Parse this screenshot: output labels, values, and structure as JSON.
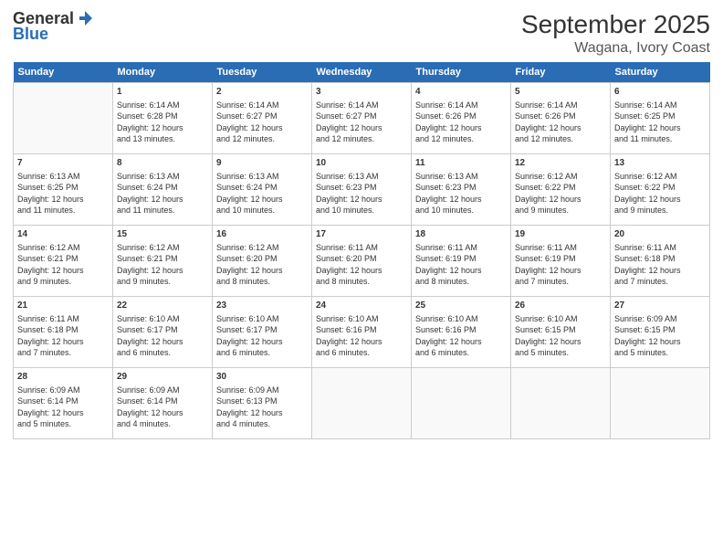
{
  "logo": {
    "general": "General",
    "blue": "Blue",
    "icon": "▶"
  },
  "title": "September 2025",
  "subtitle": "Wagana, Ivory Coast",
  "days": [
    "Sunday",
    "Monday",
    "Tuesday",
    "Wednesday",
    "Thursday",
    "Friday",
    "Saturday"
  ],
  "weeks": [
    [
      {
        "num": "",
        "lines": []
      },
      {
        "num": "1",
        "lines": [
          "Sunrise: 6:14 AM",
          "Sunset: 6:28 PM",
          "Daylight: 12 hours",
          "and 13 minutes."
        ]
      },
      {
        "num": "2",
        "lines": [
          "Sunrise: 6:14 AM",
          "Sunset: 6:27 PM",
          "Daylight: 12 hours",
          "and 12 minutes."
        ]
      },
      {
        "num": "3",
        "lines": [
          "Sunrise: 6:14 AM",
          "Sunset: 6:27 PM",
          "Daylight: 12 hours",
          "and 12 minutes."
        ]
      },
      {
        "num": "4",
        "lines": [
          "Sunrise: 6:14 AM",
          "Sunset: 6:26 PM",
          "Daylight: 12 hours",
          "and 12 minutes."
        ]
      },
      {
        "num": "5",
        "lines": [
          "Sunrise: 6:14 AM",
          "Sunset: 6:26 PM",
          "Daylight: 12 hours",
          "and 12 minutes."
        ]
      },
      {
        "num": "6",
        "lines": [
          "Sunrise: 6:14 AM",
          "Sunset: 6:25 PM",
          "Daylight: 12 hours",
          "and 11 minutes."
        ]
      }
    ],
    [
      {
        "num": "7",
        "lines": [
          "Sunrise: 6:13 AM",
          "Sunset: 6:25 PM",
          "Daylight: 12 hours",
          "and 11 minutes."
        ]
      },
      {
        "num": "8",
        "lines": [
          "Sunrise: 6:13 AM",
          "Sunset: 6:24 PM",
          "Daylight: 12 hours",
          "and 11 minutes."
        ]
      },
      {
        "num": "9",
        "lines": [
          "Sunrise: 6:13 AM",
          "Sunset: 6:24 PM",
          "Daylight: 12 hours",
          "and 10 minutes."
        ]
      },
      {
        "num": "10",
        "lines": [
          "Sunrise: 6:13 AM",
          "Sunset: 6:23 PM",
          "Daylight: 12 hours",
          "and 10 minutes."
        ]
      },
      {
        "num": "11",
        "lines": [
          "Sunrise: 6:13 AM",
          "Sunset: 6:23 PM",
          "Daylight: 12 hours",
          "and 10 minutes."
        ]
      },
      {
        "num": "12",
        "lines": [
          "Sunrise: 6:12 AM",
          "Sunset: 6:22 PM",
          "Daylight: 12 hours",
          "and 9 minutes."
        ]
      },
      {
        "num": "13",
        "lines": [
          "Sunrise: 6:12 AM",
          "Sunset: 6:22 PM",
          "Daylight: 12 hours",
          "and 9 minutes."
        ]
      }
    ],
    [
      {
        "num": "14",
        "lines": [
          "Sunrise: 6:12 AM",
          "Sunset: 6:21 PM",
          "Daylight: 12 hours",
          "and 9 minutes."
        ]
      },
      {
        "num": "15",
        "lines": [
          "Sunrise: 6:12 AM",
          "Sunset: 6:21 PM",
          "Daylight: 12 hours",
          "and 9 minutes."
        ]
      },
      {
        "num": "16",
        "lines": [
          "Sunrise: 6:12 AM",
          "Sunset: 6:20 PM",
          "Daylight: 12 hours",
          "and 8 minutes."
        ]
      },
      {
        "num": "17",
        "lines": [
          "Sunrise: 6:11 AM",
          "Sunset: 6:20 PM",
          "Daylight: 12 hours",
          "and 8 minutes."
        ]
      },
      {
        "num": "18",
        "lines": [
          "Sunrise: 6:11 AM",
          "Sunset: 6:19 PM",
          "Daylight: 12 hours",
          "and 8 minutes."
        ]
      },
      {
        "num": "19",
        "lines": [
          "Sunrise: 6:11 AM",
          "Sunset: 6:19 PM",
          "Daylight: 12 hours",
          "and 7 minutes."
        ]
      },
      {
        "num": "20",
        "lines": [
          "Sunrise: 6:11 AM",
          "Sunset: 6:18 PM",
          "Daylight: 12 hours",
          "and 7 minutes."
        ]
      }
    ],
    [
      {
        "num": "21",
        "lines": [
          "Sunrise: 6:11 AM",
          "Sunset: 6:18 PM",
          "Daylight: 12 hours",
          "and 7 minutes."
        ]
      },
      {
        "num": "22",
        "lines": [
          "Sunrise: 6:10 AM",
          "Sunset: 6:17 PM",
          "Daylight: 12 hours",
          "and 6 minutes."
        ]
      },
      {
        "num": "23",
        "lines": [
          "Sunrise: 6:10 AM",
          "Sunset: 6:17 PM",
          "Daylight: 12 hours",
          "and 6 minutes."
        ]
      },
      {
        "num": "24",
        "lines": [
          "Sunrise: 6:10 AM",
          "Sunset: 6:16 PM",
          "Daylight: 12 hours",
          "and 6 minutes."
        ]
      },
      {
        "num": "25",
        "lines": [
          "Sunrise: 6:10 AM",
          "Sunset: 6:16 PM",
          "Daylight: 12 hours",
          "and 6 minutes."
        ]
      },
      {
        "num": "26",
        "lines": [
          "Sunrise: 6:10 AM",
          "Sunset: 6:15 PM",
          "Daylight: 12 hours",
          "and 5 minutes."
        ]
      },
      {
        "num": "27",
        "lines": [
          "Sunrise: 6:09 AM",
          "Sunset: 6:15 PM",
          "Daylight: 12 hours",
          "and 5 minutes."
        ]
      }
    ],
    [
      {
        "num": "28",
        "lines": [
          "Sunrise: 6:09 AM",
          "Sunset: 6:14 PM",
          "Daylight: 12 hours",
          "and 5 minutes."
        ]
      },
      {
        "num": "29",
        "lines": [
          "Sunrise: 6:09 AM",
          "Sunset: 6:14 PM",
          "Daylight: 12 hours",
          "and 4 minutes."
        ]
      },
      {
        "num": "30",
        "lines": [
          "Sunrise: 6:09 AM",
          "Sunset: 6:13 PM",
          "Daylight: 12 hours",
          "and 4 minutes."
        ]
      },
      {
        "num": "",
        "lines": []
      },
      {
        "num": "",
        "lines": []
      },
      {
        "num": "",
        "lines": []
      },
      {
        "num": "",
        "lines": []
      }
    ]
  ]
}
